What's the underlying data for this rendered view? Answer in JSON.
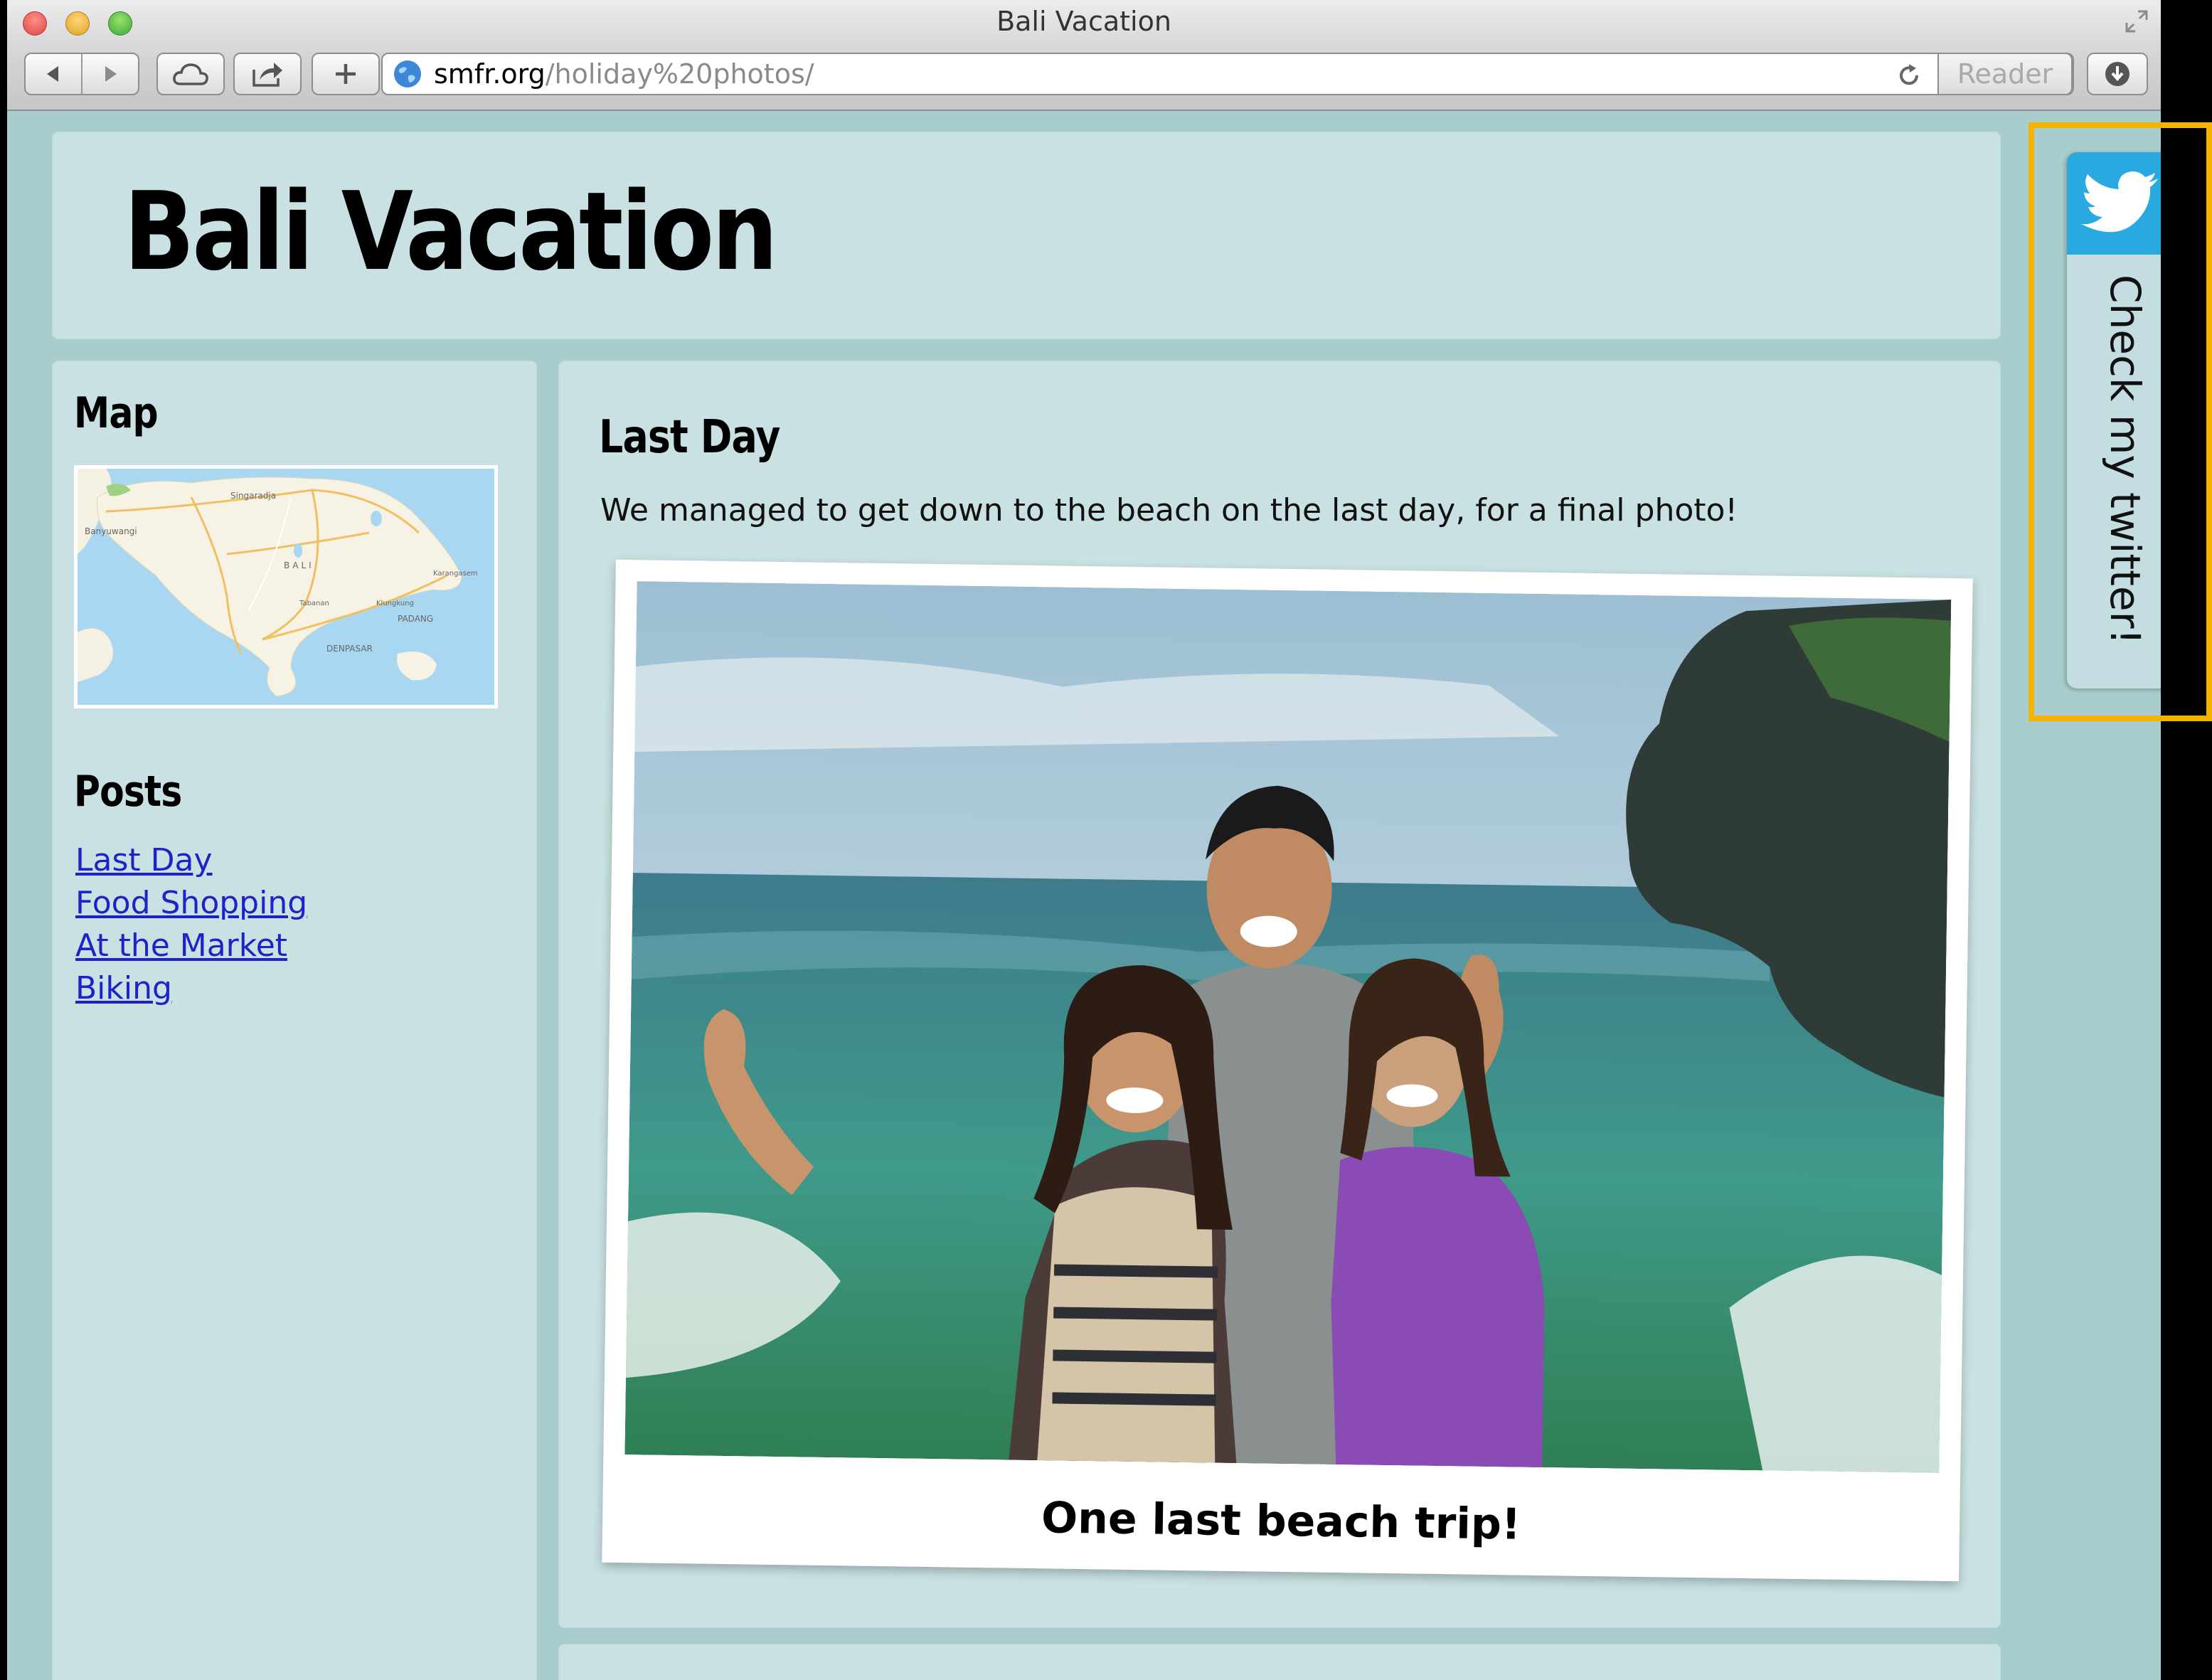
{
  "browser": {
    "window_title": "Bali Vacation",
    "url_host": "smfr.org",
    "url_path": "/holiday%20photos/",
    "reader_label": "Reader"
  },
  "page": {
    "site_title": "Bali Vacation",
    "sidebar": {
      "map_heading": "Map",
      "map_labels": [
        "Singaradja",
        "Banyuwangi",
        "BALI",
        "Karangasem",
        "Tabanan",
        "Klungkung",
        "PADANG",
        "DENPASAR"
      ],
      "posts_heading": "Posts",
      "posts": [
        "Last Day",
        "Food Shopping",
        "At the Market",
        "Biking"
      ]
    },
    "post": {
      "title": "Last Day",
      "body": "We managed to get down to the beach on the last day, for a final photo!",
      "caption": "One last beach trip!"
    },
    "twitter_tab": {
      "label": "Check my twitter!",
      "icon": "twitter-bird-icon",
      "color": "#2aa9e0"
    },
    "highlight_color": "#f5b300"
  }
}
